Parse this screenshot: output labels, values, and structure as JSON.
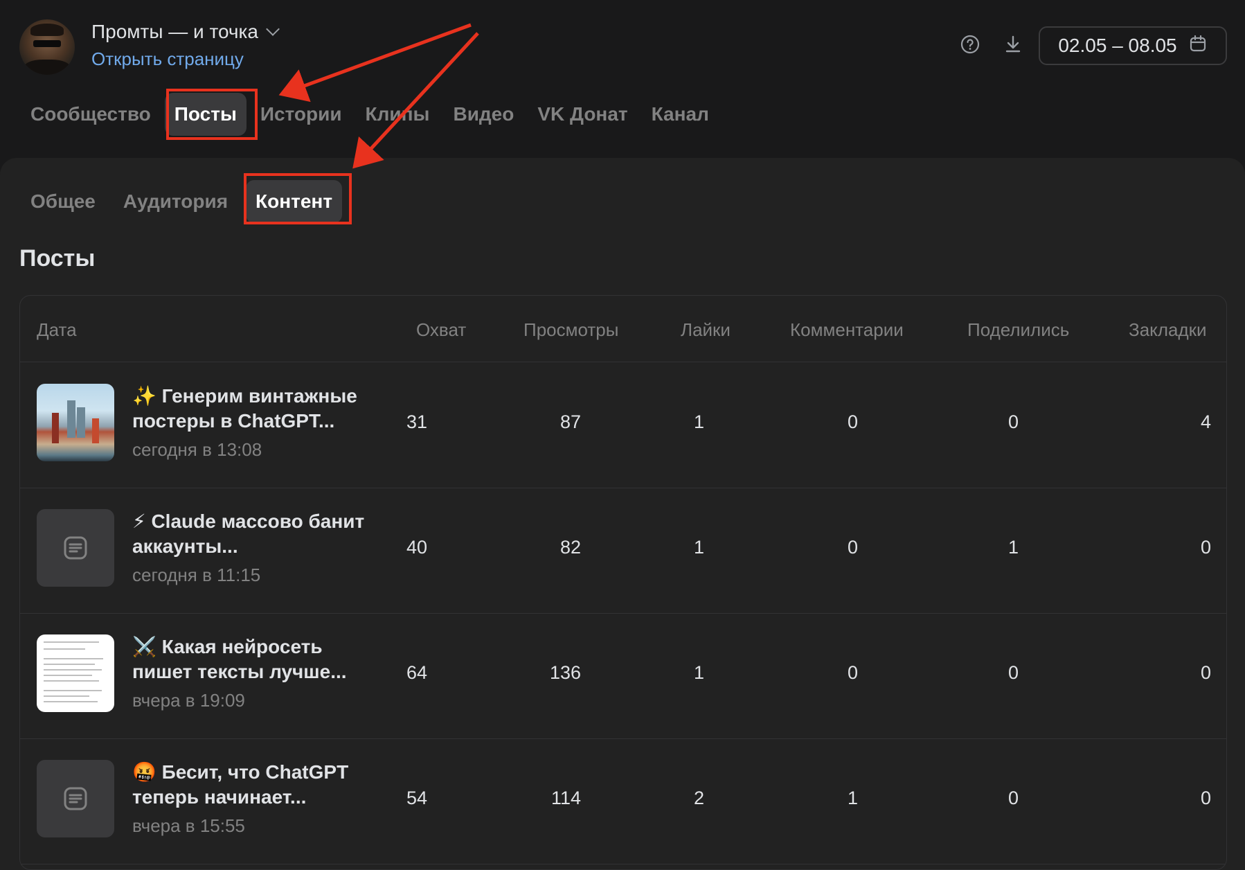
{
  "header": {
    "community_name": "Промты — и точка",
    "open_link": "Открыть страницу",
    "date_range": "02.05 – 08.05"
  },
  "main_tabs": [
    {
      "label": "Сообщество",
      "active": false
    },
    {
      "label": "Посты",
      "active": true
    },
    {
      "label": "Истории",
      "active": false
    },
    {
      "label": "Клипы",
      "active": false
    },
    {
      "label": "Видео",
      "active": false
    },
    {
      "label": "VK Донат",
      "active": false
    },
    {
      "label": "Канал",
      "active": false
    }
  ],
  "sub_tabs": [
    {
      "label": "Общее",
      "active": false
    },
    {
      "label": "Аудитория",
      "active": false
    },
    {
      "label": "Контент",
      "active": true
    }
  ],
  "section_title": "Посты",
  "table": {
    "columns": [
      "Дата",
      "Охват",
      "Просмотры",
      "Лайки",
      "Комментарии",
      "Поделились",
      "Закладки"
    ],
    "rows": [
      {
        "title": "✨ Генерим винтажные постеры в ChatGPT...",
        "date": "сегодня в 13:08",
        "thumb": "city-poster-image",
        "reach": "31",
        "views": "87",
        "likes": "1",
        "comments": "0",
        "shares": "0",
        "bookmarks": "4"
      },
      {
        "title": "⚡ Claude массово банит аккаунты...",
        "date": "сегодня в 11:15",
        "thumb": "text-post-icon",
        "reach": "40",
        "views": "82",
        "likes": "1",
        "comments": "0",
        "shares": "1",
        "bookmarks": "0"
      },
      {
        "title": "⚔️ Какая нейросеть пишет тексты лучше...",
        "date": "вчера в 19:09",
        "thumb": "document-image",
        "reach": "64",
        "views": "136",
        "likes": "1",
        "comments": "0",
        "shares": "0",
        "bookmarks": "0"
      },
      {
        "title": "🤬 Бесит, что ChatGPT теперь начинает...",
        "date": "вчера в 15:55",
        "thumb": "text-post-icon",
        "reach": "54",
        "views": "114",
        "likes": "2",
        "comments": "1",
        "shares": "0",
        "bookmarks": "0"
      }
    ]
  },
  "colors": {
    "background": "#19191a",
    "panel": "#222222",
    "link": "#71aaeb",
    "highlight": "#e8321e",
    "active_tab": "#3a3a3c"
  },
  "icons": [
    "help-icon",
    "download-icon",
    "calendar-icon",
    "chevron-down-icon",
    "text-post-icon"
  ]
}
